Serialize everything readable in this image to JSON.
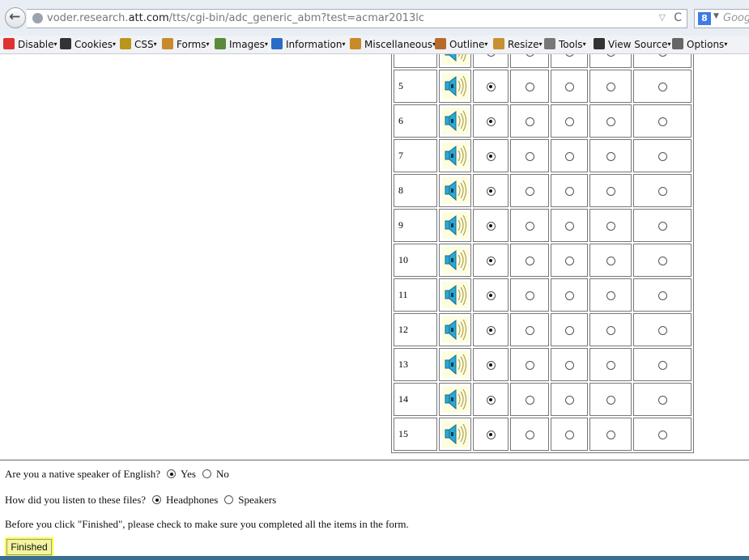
{
  "browser": {
    "url_prefix": "voder.research.",
    "url_domain": "att.com",
    "url_path": "/tts/cgi-bin/adc_generic_abm?test=acmar2013lc",
    "search_placeholder": "Googl",
    "search_engine_letter": "8"
  },
  "toolbar": {
    "items": [
      {
        "label": "Disable",
        "icon": "disable-icon"
      },
      {
        "label": "Cookies",
        "icon": "cookies-icon"
      },
      {
        "label": "CSS",
        "icon": "css-wand-icon"
      },
      {
        "label": "Forms",
        "icon": "forms-icon"
      },
      {
        "label": "Images",
        "icon": "images-icon"
      },
      {
        "label": "Information",
        "icon": "info-icon"
      },
      {
        "label": "Miscellaneous",
        "icon": "misc-icon"
      },
      {
        "label": "Outline",
        "icon": "pencil-icon"
      },
      {
        "label": "Resize",
        "icon": "ruler-icon"
      },
      {
        "label": "Tools",
        "icon": "tools-icon"
      },
      {
        "label": "View Source",
        "icon": "view-source-icon"
      },
      {
        "label": "Options",
        "icon": "options-icon"
      }
    ]
  },
  "rating_table": {
    "rows": [
      {
        "num": "",
        "selected": 0
      },
      {
        "num": "5",
        "selected": 0
      },
      {
        "num": "6",
        "selected": 0
      },
      {
        "num": "7",
        "selected": 0
      },
      {
        "num": "8",
        "selected": 0
      },
      {
        "num": "9",
        "selected": 0
      },
      {
        "num": "10",
        "selected": 0
      },
      {
        "num": "11",
        "selected": 0
      },
      {
        "num": "12",
        "selected": 0
      },
      {
        "num": "13",
        "selected": 0
      },
      {
        "num": "14",
        "selected": 0
      },
      {
        "num": "15",
        "selected": 0
      }
    ],
    "option_count": 5
  },
  "questions": {
    "native": {
      "text": "Are you a native speaker of English?",
      "yes": "Yes",
      "no": "No",
      "selected": "Yes"
    },
    "listen": {
      "text": "How did you listen to these files?",
      "headphones": "Headphones",
      "speakers": "Speakers",
      "selected": "Headphones"
    },
    "reminder": "Before you click \"Finished\", please check to make sure you completed all the items in the form."
  },
  "finish_label": "Finished",
  "colors": {
    "finish_highlight": "#ffff33",
    "speaker_bg": "#fdfde0",
    "speaker_blue": "#2aa9d6"
  }
}
